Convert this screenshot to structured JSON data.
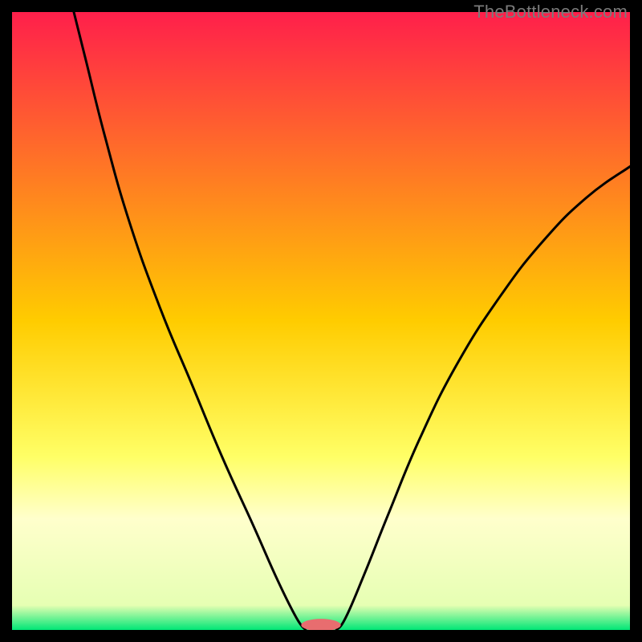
{
  "watermark": {
    "text": "TheBottleneck.com"
  },
  "chart_data": {
    "type": "line",
    "title": "",
    "xlabel": "",
    "ylabel": "",
    "xlim": [
      0,
      100
    ],
    "ylim": [
      0,
      100
    ],
    "gradient_stops": [
      {
        "offset": 0.0,
        "color": "#ff1f4b"
      },
      {
        "offset": 0.5,
        "color": "#ffcc00"
      },
      {
        "offset": 0.72,
        "color": "#ffff66"
      },
      {
        "offset": 0.82,
        "color": "#ffffcc"
      },
      {
        "offset": 0.96,
        "color": "#e6ffb3"
      },
      {
        "offset": 1.0,
        "color": "#00e676"
      }
    ],
    "curve_left": [
      {
        "x": 10.0,
        "y": 100.0
      },
      {
        "x": 12.0,
        "y": 92.0
      },
      {
        "x": 15.0,
        "y": 80.0
      },
      {
        "x": 19.0,
        "y": 66.0
      },
      {
        "x": 24.0,
        "y": 52.0
      },
      {
        "x": 29.0,
        "y": 40.0
      },
      {
        "x": 34.0,
        "y": 28.0
      },
      {
        "x": 39.0,
        "y": 17.0
      },
      {
        "x": 43.0,
        "y": 8.0
      },
      {
        "x": 46.0,
        "y": 2.0
      },
      {
        "x": 47.5,
        "y": 0.0
      }
    ],
    "curve_right": [
      {
        "x": 52.5,
        "y": 0.0
      },
      {
        "x": 54.0,
        "y": 2.0
      },
      {
        "x": 57.0,
        "y": 9.0
      },
      {
        "x": 61.0,
        "y": 19.0
      },
      {
        "x": 66.0,
        "y": 31.0
      },
      {
        "x": 72.0,
        "y": 43.0
      },
      {
        "x": 79.0,
        "y": 54.0
      },
      {
        "x": 86.0,
        "y": 63.0
      },
      {
        "x": 93.0,
        "y": 70.0
      },
      {
        "x": 100.0,
        "y": 75.0
      }
    ],
    "marker": {
      "cx": 50.0,
      "cy": 0.8,
      "rx": 3.2,
      "ry": 1.0,
      "color": "#e86d6f"
    }
  }
}
